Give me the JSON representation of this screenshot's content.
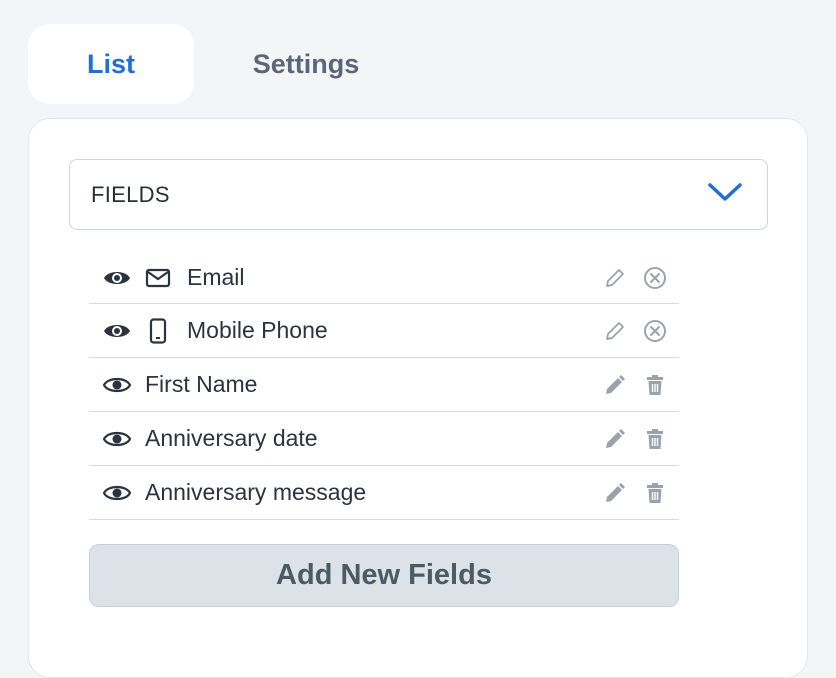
{
  "tabs": [
    {
      "label": "List",
      "active": true
    },
    {
      "label": "Settings",
      "active": false
    }
  ],
  "fields_select": {
    "label": "FIELDS",
    "icon": "chevron-down-icon"
  },
  "fields": [
    {
      "label": "Email",
      "type_icon": "mail-icon",
      "actions": [
        "pencil-outline-icon",
        "circle-x-icon"
      ]
    },
    {
      "label": "Mobile Phone",
      "type_icon": "mobile-phone-icon",
      "actions": [
        "pencil-outline-icon",
        "circle-x-icon"
      ]
    },
    {
      "label": "First Name",
      "type_icon": null,
      "actions": [
        "pencil-filled-icon",
        "trash-icon"
      ]
    },
    {
      "label": "Anniversary date",
      "type_icon": null,
      "actions": [
        "pencil-filled-icon",
        "trash-icon"
      ]
    },
    {
      "label": "Anniversary message",
      "type_icon": null,
      "actions": [
        "pencil-filled-icon",
        "trash-icon"
      ]
    }
  ],
  "add_button": {
    "label": "Add New Fields"
  },
  "colors": {
    "accent": "#1f6fd9",
    "text": "#2c3340",
    "muted_icon": "#9aa3ad",
    "button_bg": "#dbe2e8"
  }
}
